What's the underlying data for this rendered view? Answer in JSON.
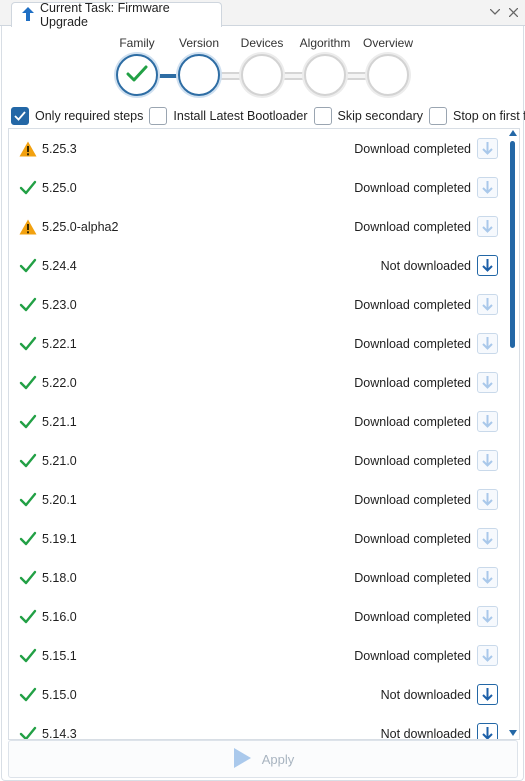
{
  "tab": {
    "title": "Current Task: Firmware Upgrade"
  },
  "steps": [
    {
      "label": "Family",
      "state": "done"
    },
    {
      "label": "Version",
      "state": "current"
    },
    {
      "label": "Devices",
      "state": "todo"
    },
    {
      "label": "Algorithm",
      "state": "todo"
    },
    {
      "label": "Overview",
      "state": "todo"
    }
  ],
  "options": [
    {
      "label": "Only required steps",
      "checked": true
    },
    {
      "label": "Install Latest Bootloader",
      "checked": false
    },
    {
      "label": "Skip secondary",
      "checked": false
    },
    {
      "label": "Stop on first fail",
      "checked": false
    }
  ],
  "versions": [
    {
      "version": "5.25.3",
      "status": "warning",
      "download_state": "Download completed",
      "downloaded": true
    },
    {
      "version": "5.25.0",
      "status": "ok",
      "download_state": "Download completed",
      "downloaded": true
    },
    {
      "version": "5.25.0-alpha2",
      "status": "warning",
      "download_state": "Download completed",
      "downloaded": true
    },
    {
      "version": "5.24.4",
      "status": "ok",
      "download_state": "Not downloaded",
      "downloaded": false
    },
    {
      "version": "5.23.0",
      "status": "ok",
      "download_state": "Download completed",
      "downloaded": true
    },
    {
      "version": "5.22.1",
      "status": "ok",
      "download_state": "Download completed",
      "downloaded": true
    },
    {
      "version": "5.22.0",
      "status": "ok",
      "download_state": "Download completed",
      "downloaded": true
    },
    {
      "version": "5.21.1",
      "status": "ok",
      "download_state": "Download completed",
      "downloaded": true
    },
    {
      "version": "5.21.0",
      "status": "ok",
      "download_state": "Download completed",
      "downloaded": true
    },
    {
      "version": "5.20.1",
      "status": "ok",
      "download_state": "Download completed",
      "downloaded": true
    },
    {
      "version": "5.19.1",
      "status": "ok",
      "download_state": "Download completed",
      "downloaded": true
    },
    {
      "version": "5.18.0",
      "status": "ok",
      "download_state": "Download completed",
      "downloaded": true
    },
    {
      "version": "5.16.0",
      "status": "ok",
      "download_state": "Download completed",
      "downloaded": true
    },
    {
      "version": "5.15.1",
      "status": "ok",
      "download_state": "Download completed",
      "downloaded": true
    },
    {
      "version": "5.15.0",
      "status": "ok",
      "download_state": "Not downloaded",
      "downloaded": false
    },
    {
      "version": "5.14.3",
      "status": "ok",
      "download_state": "Not downloaded",
      "downloaded": false
    }
  ],
  "apply": {
    "label": "Apply"
  },
  "colors": {
    "accent": "#2367a6",
    "check": "#22a045",
    "warning": "#f2a10f"
  }
}
